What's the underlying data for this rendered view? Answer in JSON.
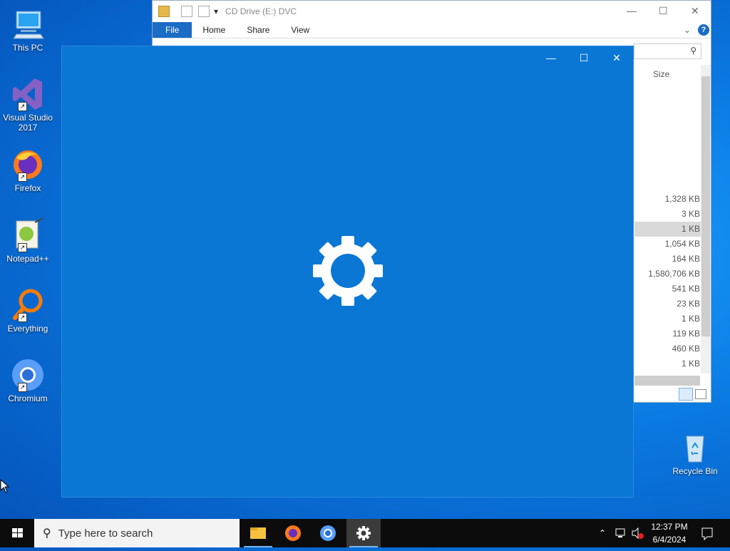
{
  "desktop": {
    "icons": [
      {
        "label": "This PC",
        "icon": "computer-icon"
      },
      {
        "label": "Visual Studio 2017",
        "icon": "visual-studio-icon"
      },
      {
        "label": "Firefox",
        "icon": "firefox-icon"
      },
      {
        "label": "Notepad++",
        "icon": "notepadpp-icon"
      },
      {
        "label": "Everything",
        "icon": "everything-search-icon"
      },
      {
        "label": "Chromium",
        "icon": "chromium-icon"
      }
    ],
    "recycle_bin": "Recycle Bin"
  },
  "explorer": {
    "title": "CD Drive (E:) DVC",
    "tabs": [
      "File",
      "Home",
      "Share",
      "View"
    ],
    "size_header": "Size",
    "sizes": [
      "1,328 KB",
      "3 KB",
      "1 KB",
      "1,054 KB",
      "164 KB",
      "1,580,706 KB",
      "541 KB",
      "23 KB",
      "1 KB",
      "119 KB",
      "460 KB",
      "1 KB"
    ],
    "selected_row_index": 2
  },
  "app_window": {
    "state": "loading",
    "icon": "gear-icon",
    "background": "#0a77d5"
  },
  "taskbar": {
    "search_placeholder": "Type here to search",
    "apps": [
      "file-explorer-icon",
      "firefox-icon",
      "chromium-icon",
      "settings-gear-icon"
    ],
    "active_app": "settings-gear-icon",
    "time": "12:37 PM",
    "date": "6/4/2024"
  }
}
